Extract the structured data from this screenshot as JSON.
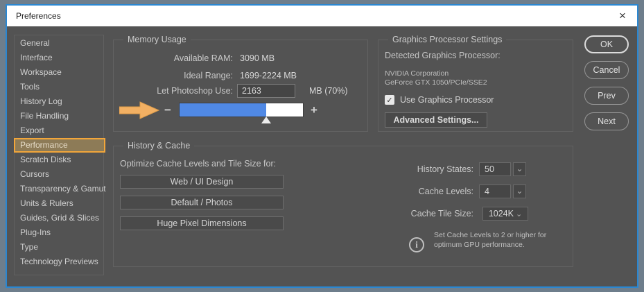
{
  "window": {
    "title": "Preferences",
    "close_icon": "×"
  },
  "sidebar": {
    "items": [
      "General",
      "Interface",
      "Workspace",
      "Tools",
      "History Log",
      "File Handling",
      "Export",
      "Performance",
      "Scratch Disks",
      "Cursors",
      "Transparency & Gamut",
      "Units & Rulers",
      "Guides, Grid & Slices",
      "Plug-Ins",
      "Type",
      "Technology Previews"
    ],
    "selected": "Performance"
  },
  "memory": {
    "title": "Memory Usage",
    "available_ram_label": "Available RAM:",
    "available_ram_value": "3090 MB",
    "ideal_range_label": "Ideal Range:",
    "ideal_range_value": "1699-2224 MB",
    "let_use_label": "Let Photoshop Use:",
    "let_use_value": "2163",
    "let_use_suffix": "MB (70%)",
    "slider": {
      "minus_icon": "−",
      "plus_icon": "+",
      "fill_percent": 70
    }
  },
  "gpu": {
    "title": "Graphics Processor Settings",
    "detected_label": "Detected Graphics Processor:",
    "vendor": "NVIDIA Corporation",
    "model": "GeForce GTX 1050/PCIe/SSE2",
    "use_gpu_label": "Use Graphics Processor",
    "use_gpu_checked": true,
    "check_icon": "✓",
    "advanced_button": "Advanced Settings..."
  },
  "history_cache": {
    "title": "History & Cache",
    "optimize_label": "Optimize Cache Levels and Tile Size for:",
    "preset_buttons": [
      "Web / UI Design",
      "Default / Photos",
      "Huge Pixel Dimensions"
    ],
    "history_states_label": "History States:",
    "history_states_value": "50",
    "cache_levels_label": "Cache Levels:",
    "cache_levels_value": "4",
    "cache_tile_label": "Cache Tile Size:",
    "cache_tile_value": "1024K",
    "chevron_icon": "⌄",
    "info_icon": "i",
    "info_text_line1": "Set Cache Levels to 2 or higher for",
    "info_text_line2": "optimum GPU performance."
  },
  "action_buttons": [
    "OK",
    "Cancel",
    "Prev",
    "Next"
  ],
  "colors": {
    "accent_blue_border": "#2a87d2",
    "slider_fill_blue": "#5089e5",
    "annotation_orange": "#f2b063",
    "selected_item_bg": "#8d7b57",
    "selected_item_border": "#f2a63a",
    "dialog_bg": "#535353"
  }
}
